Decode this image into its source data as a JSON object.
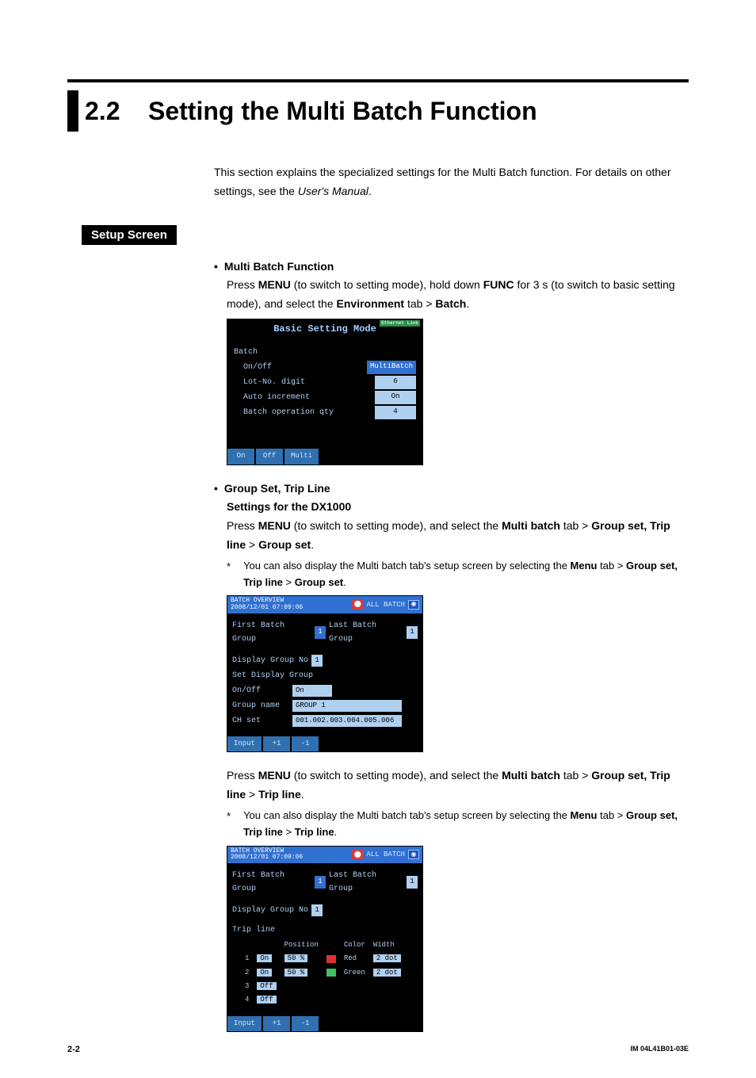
{
  "section": {
    "num": "2.2",
    "title": "Setting the Multi Batch Function"
  },
  "intro": {
    "t1": "This section explains the specialized settings for the Multi Batch function. For details on other settings, see the ",
    "t2": "User's Manual",
    "t3": "."
  },
  "setup_heading": "Setup Screen",
  "mbf": {
    "title": "Multi Batch Function",
    "p1a": "Press ",
    "p1b": "MENU",
    "p1c": " (to switch to setting mode), hold down ",
    "p1d": "FUNC",
    "p1e": " for 3 s (to switch to basic setting mode), and select the ",
    "p1f": "Environment",
    "p1g": " tab > ",
    "p1h": "Batch",
    "p1i": "."
  },
  "ss1": {
    "title": "Basic Setting Mode",
    "eth": "Ethernet Link",
    "rows": [
      {
        "label": "Batch",
        "val": ""
      },
      {
        "label": "  On/Off",
        "val": "MultiBatch",
        "hl": true
      },
      {
        "label": "  Lot-No. digit",
        "val": "6"
      },
      {
        "label": "  Auto increment",
        "val": "On"
      },
      {
        "label": "  Batch operation qty",
        "val": "4"
      }
    ],
    "footer": [
      "On",
      "Off",
      "Multi"
    ]
  },
  "gst": {
    "title": "Group Set, Trip Line",
    "sub": "Settings for the DX1000",
    "p1a": "Press ",
    "p1b": "MENU",
    "p1c": " (to switch to setting mode), and select the ",
    "p1d": "Multi batch",
    "p1e": " tab > ",
    "p1f": "Group set, Trip line",
    "p1g": " > ",
    "p1h": "Group set",
    "p1i": ".",
    "note_a": "You can also display the Multi batch tab's setup screen by selecting the ",
    "note_b": "Menu",
    "note_c": " tab > ",
    "note_d": "Group set, Trip line",
    "note_e": " > ",
    "note_f": "Group set",
    "note_g": "."
  },
  "ss2": {
    "tbl": "BATCH OVERVIEW",
    "date": "2008/12/01 07:09:06",
    "allbatch": "ALL BATCH",
    "fbg": "First Batch Group",
    "fbg_v": "1",
    "lbg": "Last Batch Group",
    "lbg_v": "1",
    "dgn": "Display Group No",
    "dgn_v": "1",
    "sdg": "Set Display Group",
    "onoff": "  On/Off",
    "onoff_v": "On",
    "gname": "  Group name",
    "gname_v": "GROUP 1",
    "chset": "  CH set",
    "chset_v": "001.002.003.004.005.006",
    "footer": [
      "Input",
      "+1",
      "-1"
    ]
  },
  "trip": {
    "p1a": "Press ",
    "p1b": "MENU",
    "p1c": " (to switch to setting mode), and select the ",
    "p1d": "Multi batch",
    "p1e": " tab > ",
    "p1f": "Group set, Trip line",
    "p1g": " > ",
    "p1h": "Trip line",
    "p1i": ".",
    "note_a": "You can also display the Multi batch tab's setup screen by selecting the ",
    "note_b": "Menu",
    "note_c": " tab > ",
    "note_d": "Group set, Trip line",
    "note_e": " > ",
    "note_f": "Trip line",
    "note_g": "."
  },
  "ss3": {
    "tl": "Trip line",
    "hdr": {
      "pos": "Position",
      "color": "Color",
      "width": "Width"
    },
    "rows": [
      {
        "n": "1",
        "onoff": "On",
        "pos": "50 %",
        "sw": "col-red",
        "color": "Red",
        "width": "2 dot"
      },
      {
        "n": "2",
        "onoff": "On",
        "pos": "50 %",
        "sw": "col-green",
        "color": "Green",
        "width": "2 dot"
      },
      {
        "n": "3",
        "onoff": "Off",
        "pos": "",
        "sw": "",
        "color": "",
        "width": ""
      },
      {
        "n": "4",
        "onoff": "Off",
        "pos": "",
        "sw": "",
        "color": "",
        "width": ""
      }
    ]
  },
  "footer": {
    "page": "2-2",
    "doc": "IM 04L41B01-03E"
  },
  "chart_data": {
    "type": "table",
    "title": "Basic Setting Mode — Batch",
    "rows": [
      [
        "On/Off",
        "MultiBatch"
      ],
      [
        "Lot-No. digit",
        "6"
      ],
      [
        "Auto increment",
        "On"
      ],
      [
        "Batch operation qty",
        "4"
      ]
    ]
  }
}
